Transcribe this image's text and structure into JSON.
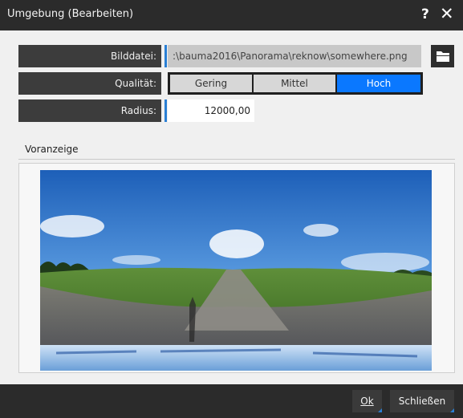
{
  "window": {
    "title": "Umgebung (Bearbeiten)",
    "help_label": "?",
    "close_label": "✕"
  },
  "form": {
    "file": {
      "label": "Bilddatei:",
      "value": ":\\bauma2016\\Panorama\\reknow\\somewhere.png"
    },
    "quality": {
      "label": "Qualität:",
      "options": [
        "Gering",
        "Mittel",
        "Hoch"
      ],
      "selected": "Hoch"
    },
    "radius": {
      "label": "Radius:",
      "value": "12000,00"
    }
  },
  "preview": {
    "heading": "Voranzeige"
  },
  "buttons": {
    "ok": "Ok",
    "close": "Schließen"
  },
  "colors": {
    "accent": "#2a7fd4",
    "selected_option": "#0a78ff",
    "titlebar": "#2b2b2b",
    "label_bg": "#3c3c3c"
  },
  "icons": {
    "folder": "folder-icon"
  }
}
